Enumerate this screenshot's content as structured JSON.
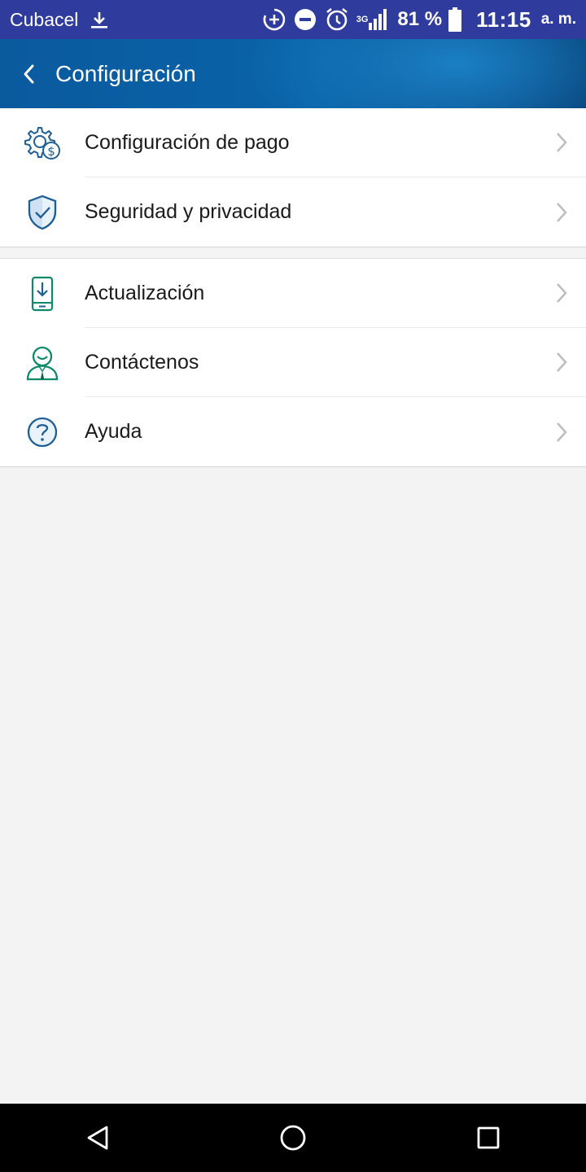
{
  "status_bar": {
    "carrier": "Cubacel",
    "network": "3G",
    "battery": "81 %",
    "time": "11:15",
    "ampm": "a. m."
  },
  "app_bar": {
    "title": "Configuración"
  },
  "groups": [
    {
      "items": [
        {
          "label": "Configuración de pago",
          "icon": "payment-settings-icon"
        },
        {
          "label": "Seguridad y privacidad",
          "icon": "shield-check-icon"
        }
      ]
    },
    {
      "items": [
        {
          "label": "Actualización",
          "icon": "phone-download-icon"
        },
        {
          "label": "Contáctenos",
          "icon": "support-agent-icon"
        },
        {
          "label": "Ayuda",
          "icon": "help-circle-icon"
        }
      ]
    }
  ],
  "colors": {
    "status_bar": "#2f3c9e",
    "app_bar": "#0a5a9e",
    "background": "#f3f3f3",
    "icon_blue": "#1f5f96",
    "icon_green": "#0d8a6a"
  }
}
